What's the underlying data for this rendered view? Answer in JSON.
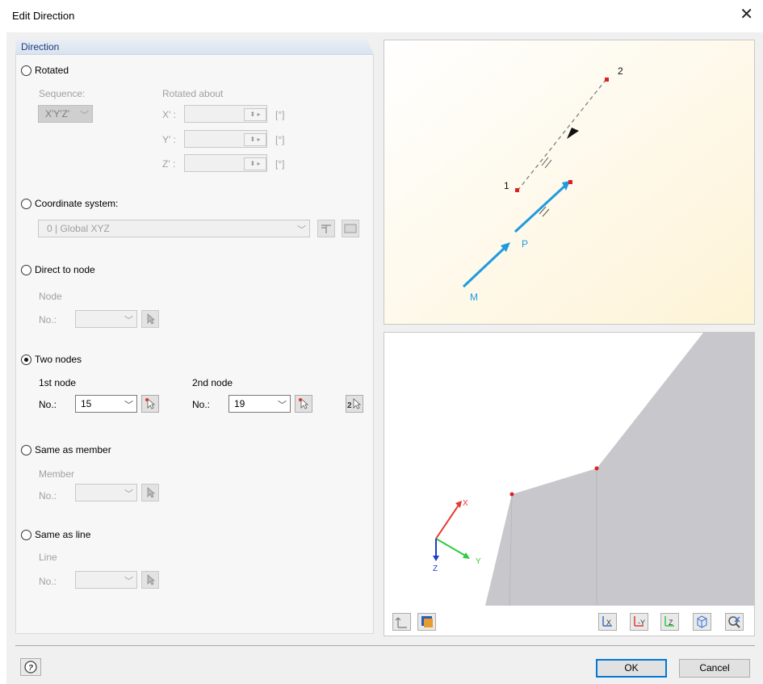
{
  "window": {
    "title": "Edit Direction",
    "close_icon": "close-icon"
  },
  "direction": {
    "group_title": "Direction",
    "rotated": {
      "label": "Rotated",
      "selected": false,
      "sequence_label": "Sequence:",
      "sequence_value": "X'Y'Z'",
      "rotated_about_label": "Rotated about",
      "axes": [
        {
          "label": "X' :",
          "value": "",
          "unit": "[°]"
        },
        {
          "label": "Y' :",
          "value": "",
          "unit": "[°]"
        },
        {
          "label": "Z' :",
          "value": "",
          "unit": "[°]"
        }
      ]
    },
    "coordinate_system": {
      "label": "Coordinate system:",
      "selected": false,
      "value": "0 | Global XYZ"
    },
    "direct_to_node": {
      "label": "Direct to node",
      "selected": false,
      "section_label": "Node",
      "no_label": "No.:",
      "value": ""
    },
    "two_nodes": {
      "label": "Two nodes",
      "selected": true,
      "first_label": "1st node",
      "second_label": "2nd node",
      "no_label": "No.:",
      "first_value": "15",
      "second_value": "19"
    },
    "same_as_member": {
      "label": "Same as member",
      "selected": false,
      "section_label": "Member",
      "no_label": "No.:",
      "value": ""
    },
    "same_as_line": {
      "label": "Same as line",
      "selected": false,
      "section_label": "Line",
      "no_label": "No.:",
      "value": ""
    }
  },
  "preview": {
    "node_start_label": "1",
    "node_end_label": "2",
    "vector_p_label": "P",
    "vector_m_label": "M",
    "colors": {
      "vector": "#1e9be0",
      "node": "#e02020",
      "background_tint": "#fdf7e6"
    }
  },
  "model_view": {
    "axis_x_label": "X",
    "axis_y_label": "Y",
    "axis_z_label": "Z",
    "colors": {
      "surface": "#c8c8cc",
      "x_axis": "#e53935",
      "y_axis": "#2ecc40",
      "z_axis": "#1e3fc8"
    }
  },
  "toolbar": {
    "left": [
      "axis-toggle-icon",
      "display-options-icon"
    ],
    "right": [
      "view-x-icon",
      "view-y-icon",
      "view-z-icon",
      "isometric-view-icon",
      "reset-view-icon"
    ]
  },
  "footer": {
    "help_icon": "help-icon",
    "ok_label": "OK",
    "cancel_label": "Cancel"
  }
}
